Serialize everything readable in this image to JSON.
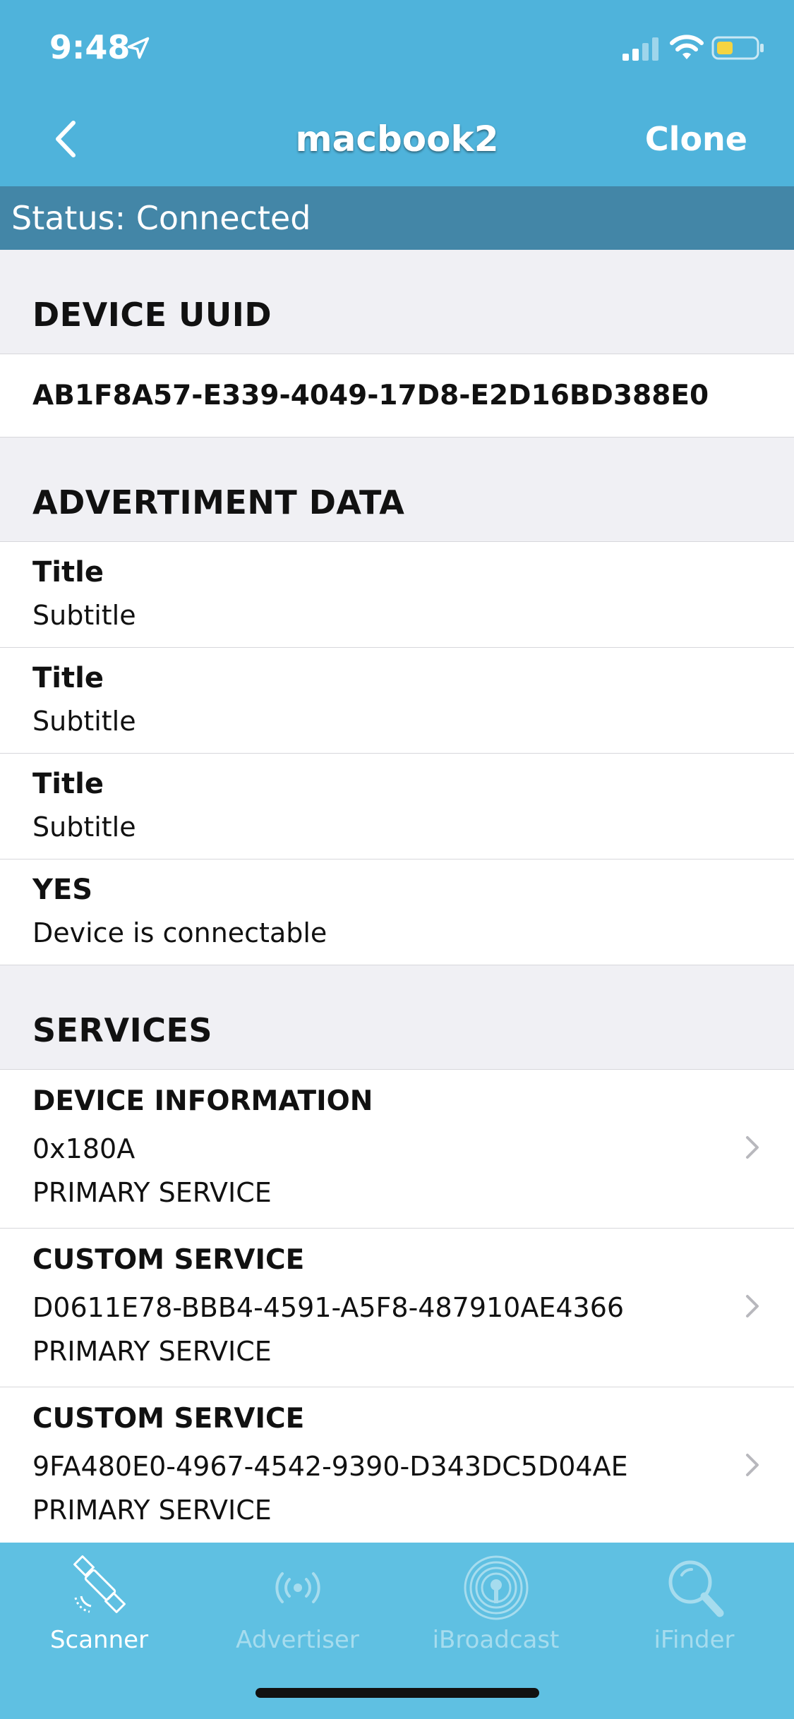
{
  "status_bar": {
    "time": "9:48"
  },
  "nav": {
    "title": "macbook2",
    "clone_label": "Clone"
  },
  "status_line": "Status: Connected",
  "device_uuid": {
    "header": "DEVICE UUID",
    "value": "AB1F8A57-E339-4049-17D8-E2D16BD388E0"
  },
  "advertisement": {
    "header": "ADVERTIMENT DATA",
    "rows": [
      {
        "title": "Title",
        "subtitle": "Subtitle"
      },
      {
        "title": "Title",
        "subtitle": "Subtitle"
      },
      {
        "title": "Title",
        "subtitle": "Subtitle"
      },
      {
        "title": "YES",
        "subtitle": "Device is connectable"
      }
    ]
  },
  "services": {
    "header": "SERVICES",
    "items": [
      {
        "name": "DEVICE INFORMATION",
        "uuid": "0x180A",
        "kind": "PRIMARY SERVICE"
      },
      {
        "name": "CUSTOM SERVICE",
        "uuid": "D0611E78-BBB4-4591-A5F8-487910AE4366",
        "kind": "PRIMARY SERVICE"
      },
      {
        "name": "CUSTOM SERVICE",
        "uuid": "9FA480E0-4967-4542-9390-D343DC5D04AE",
        "kind": "PRIMARY SERVICE"
      }
    ]
  },
  "tabs": [
    {
      "label": "Scanner",
      "icon": "satellite-icon",
      "active": true
    },
    {
      "label": "Advertiser",
      "icon": "broadcast-icon",
      "active": false
    },
    {
      "label": "iBroadcast",
      "icon": "ibeacon-icon",
      "active": false
    },
    {
      "label": "iFinder",
      "icon": "magnifier-icon",
      "active": false
    }
  ],
  "colors": {
    "header_blue": "#4fb3db",
    "status_blue": "#4386a7",
    "tabbar_blue": "#5fc0e2",
    "battery_yellow": "#f5d442"
  }
}
